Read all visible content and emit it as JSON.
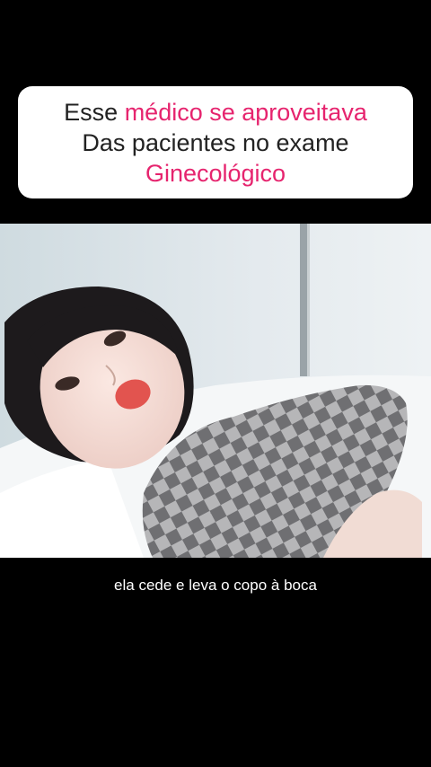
{
  "caption": {
    "line1_a": "Esse ",
    "line1_b": "médico se aproveitava",
    "line2": "Das pacientes no exame",
    "line3": "Ginecológico"
  },
  "subtitle": "ela cede e leva o copo à boca",
  "colors": {
    "background": "#000000",
    "caption_box": "#ffffff",
    "caption_text": "#222222",
    "highlight": "#e6246e",
    "subtitle_text": "#ffffff"
  }
}
